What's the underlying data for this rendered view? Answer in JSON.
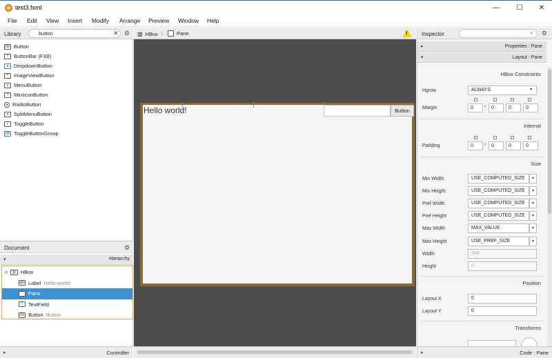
{
  "window": {
    "title": "test3.fxml",
    "minimize": "—",
    "maximize": "☐",
    "close": "✕"
  },
  "menu": [
    "File",
    "Edit",
    "View",
    "Insert",
    "Modify",
    "Arrange",
    "Preview",
    "Window",
    "Help"
  ],
  "library": {
    "title": "Library",
    "search_value": "button",
    "items": [
      {
        "label": "Button",
        "icon": "button-icon",
        "glyph": "OK"
      },
      {
        "label": "ButtonBar  (FX8)",
        "icon": "buttonbar-icon",
        "glyph": "?"
      },
      {
        "label": "DropdownButton",
        "icon": "dropdownbutton-icon",
        "glyph": "▾"
      },
      {
        "label": "ImageViewButton",
        "icon": "imageviewbutton-icon",
        "glyph": "?"
      },
      {
        "label": "MenuButton",
        "icon": "menubutton-icon",
        "glyph": "≡"
      },
      {
        "label": "MiniIconButton",
        "icon": "miniiconbutton-icon",
        "glyph": "?"
      },
      {
        "label": "RadioButton",
        "icon": "radiobutton-icon",
        "glyph": "●"
      },
      {
        "label": "SplitMenuButton",
        "icon": "splitmenubutton-icon",
        "glyph": "▾"
      },
      {
        "label": "ToggleButton",
        "icon": "togglebutton-icon",
        "glyph": "◐"
      },
      {
        "label": "ToggleButtonGroup",
        "icon": "togglebuttongroup-icon",
        "glyph": "OK"
      }
    ]
  },
  "document": {
    "title": "Document",
    "hierarchy_label": "Hierarchy",
    "tree": [
      {
        "label": "HBox",
        "hint": "",
        "glyph": "▥",
        "selected": false
      },
      {
        "label": "Label",
        "hint": "Hello world!",
        "glyph": "abc",
        "selected": false
      },
      {
        "label": "Pane",
        "hint": "",
        "glyph": "",
        "selected": true
      },
      {
        "label": "TextField",
        "hint": "",
        "glyph": "I",
        "selected": false
      },
      {
        "label": "Button",
        "hint": "Button",
        "glyph": "OK",
        "selected": false
      }
    ],
    "controller_label": "Controller"
  },
  "center": {
    "breadcrumb": [
      "HBox",
      "Pane"
    ],
    "canvas": {
      "label_text": "Hello world!",
      "button_text": "Button"
    }
  },
  "inspector": {
    "title": "Inspector",
    "properties_section": "Properties : Pane",
    "layout_section": "Layout : Pane",
    "hbox_constraints": "HBox Constraints",
    "hgrow_label": "Hgrow",
    "hgrow_value": "ALWAYS",
    "margin_label": "Margin",
    "margin_values": [
      "0",
      "0",
      "0",
      "0"
    ],
    "internal": "Internal",
    "padding_label": "Padding",
    "padding_values": [
      "0",
      "0",
      "0",
      "0"
    ],
    "size": "Size",
    "size_rows": [
      {
        "label": "Min Width",
        "value": "USE_COMPUTED_SIZE"
      },
      {
        "label": "Min Height",
        "value": "USE_COMPUTED_SIZE"
      },
      {
        "label": "Pref Width",
        "value": "USE_COMPUTED_SIZE"
      },
      {
        "label": "Pref Height",
        "value": "USE_COMPUTED_SIZE"
      },
      {
        "label": "Max Width",
        "value": "MAX_VALUE"
      },
      {
        "label": "Max Height",
        "value": "USE_PREF_SIZE"
      }
    ],
    "width_label": "Width",
    "width_value": "308",
    "height_label": "Height",
    "height_value": "0",
    "position": "Position",
    "layout_x_label": "Layout X",
    "layout_x_value": "0",
    "layout_y_label": "Layout Y",
    "layout_y_value": "0",
    "transforms": "Transforms",
    "code_section": "Code : Pane"
  },
  "colors": {
    "selection": "#3a92d6",
    "hbox_border": "#8a6a35",
    "tree_border": "#e8a43a",
    "canvas_bg": "#4c4c4c"
  }
}
